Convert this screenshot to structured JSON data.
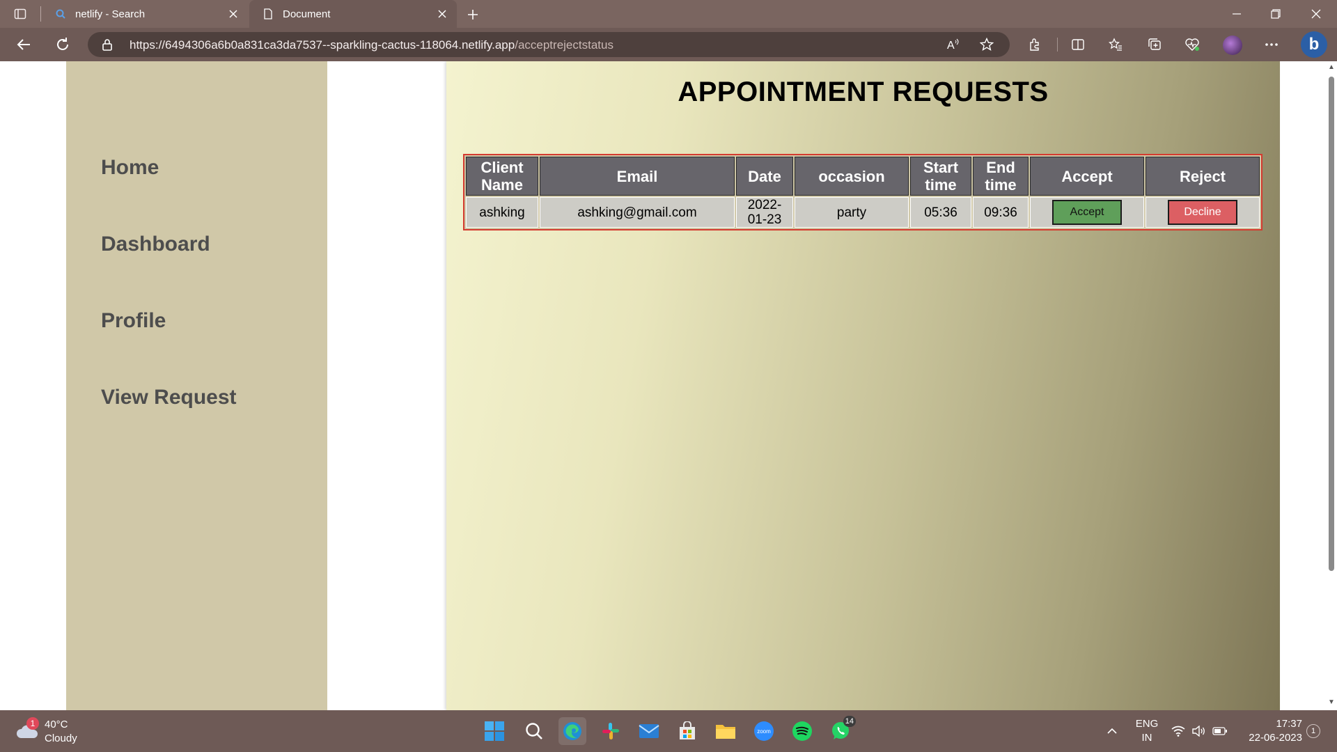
{
  "browser": {
    "tabs": [
      {
        "title": "netlify - Search",
        "active": false
      },
      {
        "title": "Document",
        "active": true
      }
    ],
    "url_main": "https://6494306a6b0a831ca3da7537--sparkling-cactus-118064.netlify.app",
    "url_path": "/acceptrejectstatus"
  },
  "sidebar": {
    "items": [
      {
        "label": "Home"
      },
      {
        "label": "Dashboard"
      },
      {
        "label": "Profile"
      },
      {
        "label": "View Request"
      }
    ]
  },
  "main": {
    "title": "APPOINTMENT REQUESTS",
    "table": {
      "headers": [
        "Client Name",
        "Email",
        "Date",
        "occasion",
        "Start time",
        "End time",
        "Accept",
        "Reject"
      ],
      "rows": [
        {
          "client_name": "ashking",
          "email": "ashking@gmail.com",
          "date": "2022-01-23",
          "occasion": "party",
          "start_time": "05:36",
          "end_time": "09:36",
          "accept_label": "Accept",
          "reject_label": "Decline"
        }
      ]
    }
  },
  "taskbar": {
    "weather": {
      "temp": "40°C",
      "condition": "Cloudy",
      "badge": "1"
    },
    "whatsapp_badge": "14",
    "language": {
      "line1": "ENG",
      "line2": "IN"
    },
    "clock": {
      "time": "17:37",
      "date": "22-06-2023"
    },
    "notifications": "1"
  },
  "colors": {
    "sidebar_bg": "#d0c8a8",
    "table_border": "#d43a2f",
    "header_bg": "#67656b",
    "accept_green": "#5f9f5a",
    "decline_red": "#dc5f63"
  }
}
